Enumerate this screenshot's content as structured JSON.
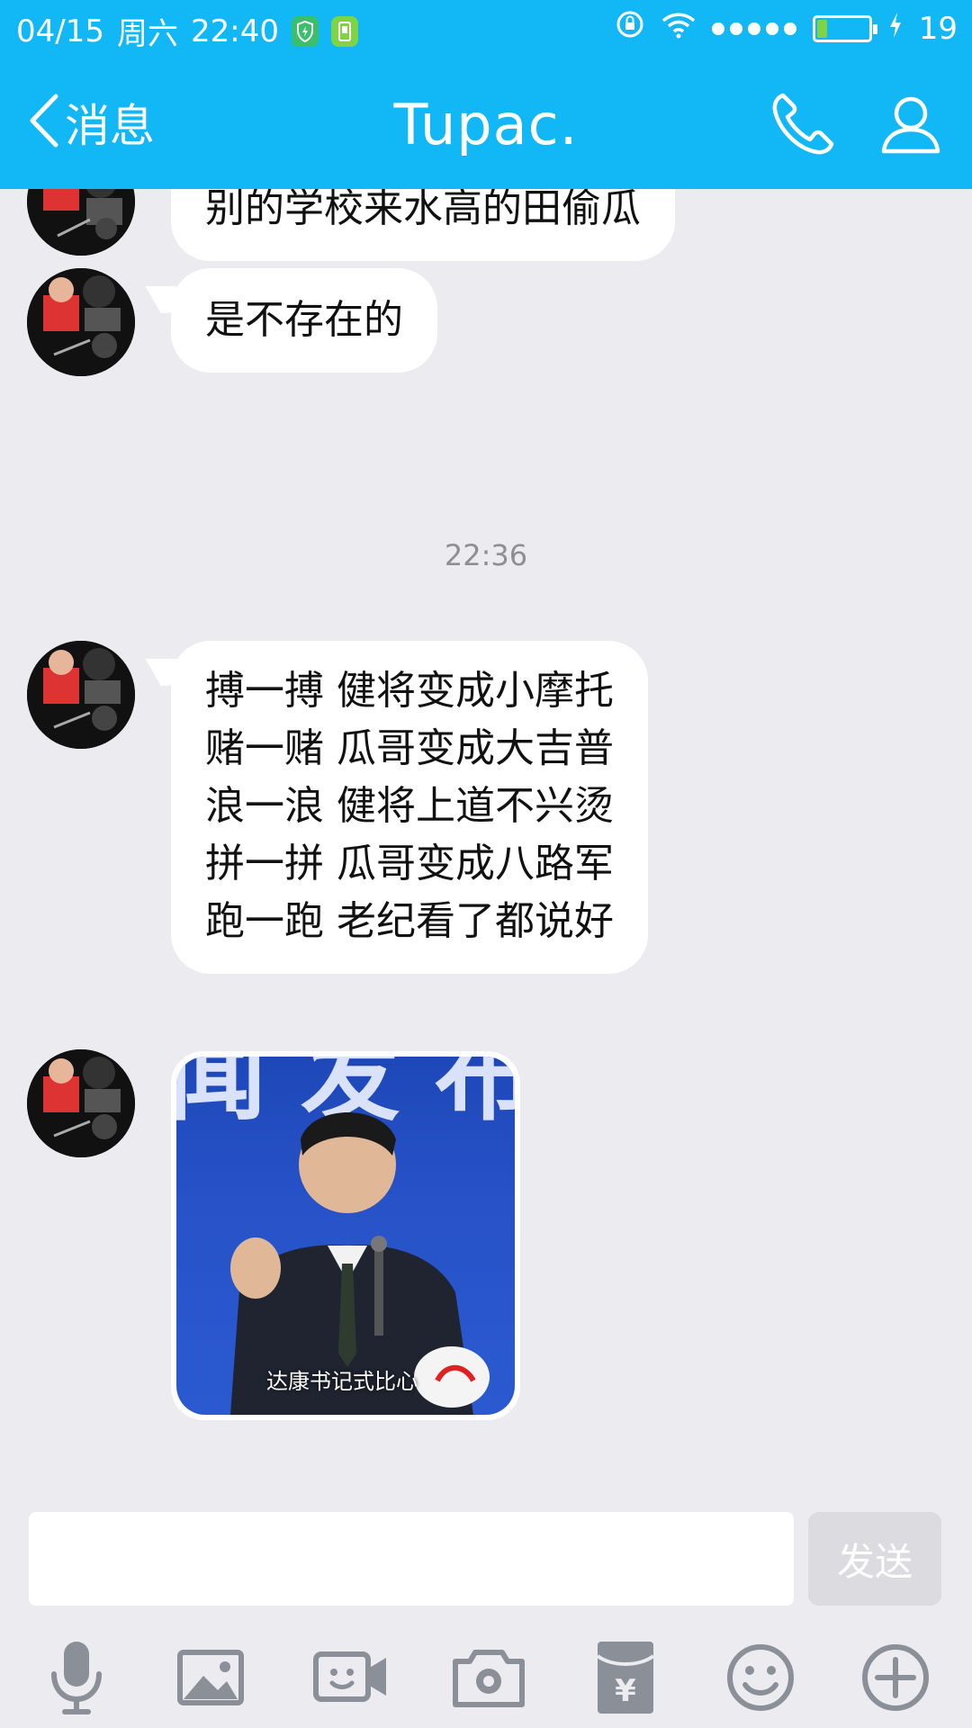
{
  "status_bar": {
    "date": "04/15",
    "weekday": "周六",
    "time": "22:40",
    "battery_level": "19",
    "battery_fill_fraction": 0.19
  },
  "header": {
    "back_label": "消息",
    "title": "Tupac."
  },
  "messages": [
    {
      "text": "别的学校来水高的田偷瓜"
    },
    {
      "text": "是不存在的"
    },
    {
      "lines": [
        "搏一搏 健将变成小摩托",
        "赌一赌 瓜哥变成大吉普",
        "浪一浪 健将上道不兴烫",
        "拼一拼 瓜哥变成八路军",
        "跑一跑 老纪看了都说好"
      ]
    },
    {
      "image_caption": "达康书记式比心"
    }
  ],
  "timestamp": "22:36",
  "input": {
    "placeholder": "",
    "send_label": "发送"
  },
  "colors": {
    "brand": "#12b7f5",
    "background": "#ebebf0",
    "icon_gray": "#8a8f98"
  },
  "toolbar_icons": [
    "mic-icon",
    "image-icon",
    "video-icon",
    "camera-icon",
    "red-packet-icon",
    "emoji-icon",
    "plus-icon"
  ]
}
